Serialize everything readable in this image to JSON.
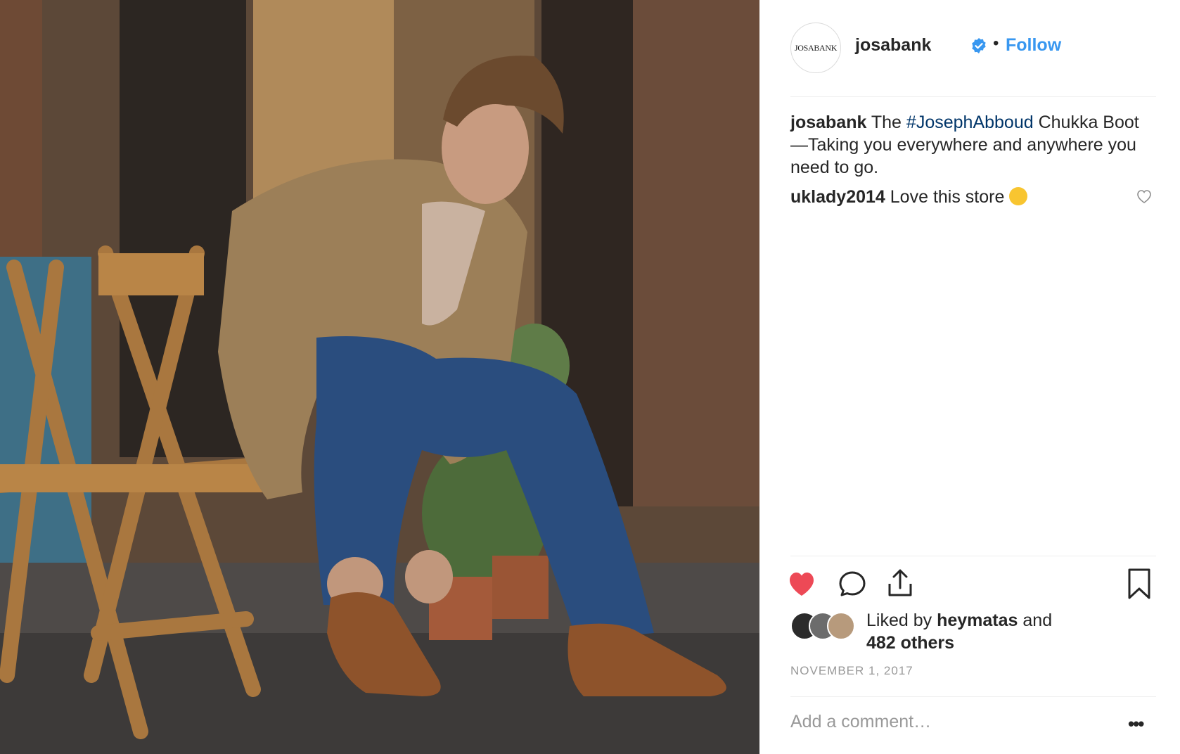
{
  "post": {
    "username": "josabank",
    "avatar_text": "JOSABANK",
    "follow_label": "Follow",
    "separator": "•",
    "caption": {
      "username": "josabank",
      "before_hashtag": "The",
      "hashtag": "#JosephAbboud",
      "after_hashtag": "Chukka Boot—Taking you everywhere and anywhere you need to go."
    },
    "comments": [
      {
        "username": "uklady2014",
        "text": "Love this store"
      }
    ],
    "likes": {
      "prefix": "Liked by",
      "first_liker": "heymatas",
      "joiner": "and",
      "others": "482 others"
    },
    "date": "NOVEMBER 1, 2017",
    "add_comment_placeholder": "Add a comment…",
    "more_label": "•••"
  },
  "icons": {
    "like": "heart-filled-icon",
    "comment": "comment-bubble-icon",
    "share": "share-upload-icon",
    "save": "bookmark-icon",
    "verified": "verified-badge-icon",
    "comment_like": "heart-outline-icon"
  },
  "colors": {
    "link": "#3897f0",
    "hashtag": "#003569",
    "liked": "#ed4956",
    "muted": "#999999",
    "text": "#262626"
  }
}
